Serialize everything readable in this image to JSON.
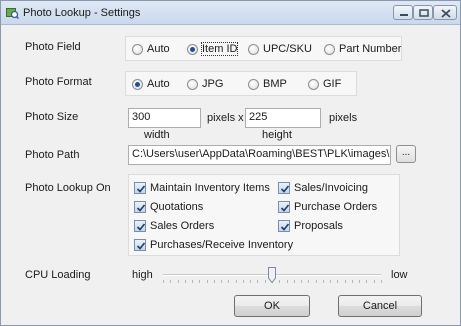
{
  "window": {
    "title": "Photo Lookup - Settings",
    "app_icon": "photo-lookup-icon",
    "buttons": {
      "minimize": "minimize-icon",
      "maximize": "maximize-icon",
      "close": "close-icon"
    }
  },
  "photo_field": {
    "label": "Photo Field",
    "options": [
      "Auto",
      "Item ID",
      "UPC/SKU",
      "Part Number"
    ],
    "selected": "Item ID"
  },
  "photo_format": {
    "label": "Photo Format",
    "options": [
      "Auto",
      "JPG",
      "BMP",
      "GIF"
    ],
    "selected": "Auto"
  },
  "photo_size": {
    "label": "Photo Size",
    "width_value": "300",
    "height_value": "225",
    "unit_x": "pixels x",
    "unit": "pixels",
    "width_caption": "width",
    "height_caption": "height"
  },
  "photo_path": {
    "label": "Photo Path",
    "value": "C:\\Users\\user\\AppData\\Roaming\\BEST\\PLK\\images\\",
    "browse_label": "..."
  },
  "photo_lookup_on": {
    "label": "Photo Lookup On",
    "items": [
      {
        "label": "Maintain Inventory Items",
        "checked": true
      },
      {
        "label": "Sales/Invoicing",
        "checked": true
      },
      {
        "label": "Quotations",
        "checked": true
      },
      {
        "label": "Purchase Orders",
        "checked": true
      },
      {
        "label": "Sales Orders",
        "checked": true
      },
      {
        "label": "Proposals",
        "checked": true
      },
      {
        "label": "Purchases/Receive Inventory",
        "checked": true
      }
    ]
  },
  "cpu_loading": {
    "label": "CPU Loading",
    "min_label": "high",
    "max_label": "low",
    "level": 0.5
  },
  "buttons": {
    "ok": "OK",
    "cancel": "Cancel"
  },
  "colors": {
    "accent": "#1e4f9a",
    "titlebar": "#c9d8ec"
  }
}
